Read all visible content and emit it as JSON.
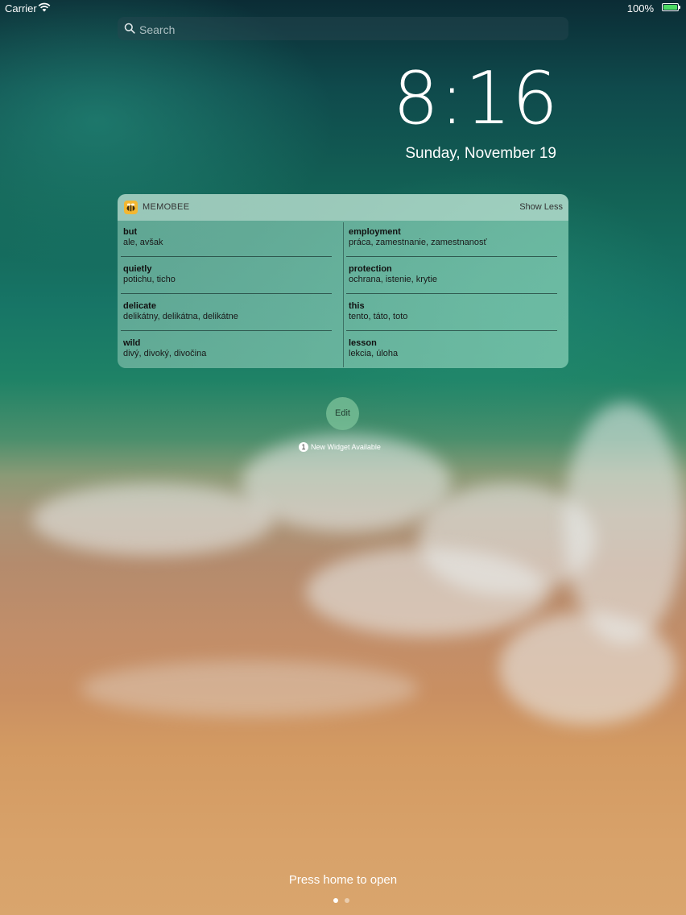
{
  "status_bar": {
    "carrier": "Carrier",
    "battery_percent": "100%"
  },
  "search": {
    "placeholder": "Search"
  },
  "lock_screen": {
    "time": "8:16",
    "date": "Sunday, November 19"
  },
  "widget": {
    "app_name": "MEMOBEE",
    "show_less_label": "Show Less",
    "entries": [
      {
        "word": "but",
        "translation": "ale, avšak"
      },
      {
        "word": "employment",
        "translation": "práca, zamestnanie, zamestnanosť"
      },
      {
        "word": "quietly",
        "translation": "potichu, ticho"
      },
      {
        "word": "protection",
        "translation": "ochrana, istenie, krytie"
      },
      {
        "word": "delicate",
        "translation": "delikátny, delikátna, delikátne"
      },
      {
        "word": "this",
        "translation": "tento, táto, toto"
      },
      {
        "word": "wild",
        "translation": "divý, divoký, divočina"
      },
      {
        "word": "lesson",
        "translation": "lekcia, úloha"
      }
    ]
  },
  "edit_button": {
    "label": "Edit"
  },
  "new_widget": {
    "count": "1",
    "text": "New Widget Available"
  },
  "footer": {
    "press_home": "Press home to open"
  },
  "page_indicator": {
    "pages": 2,
    "current": 1
  },
  "colors": {
    "battery": "#4cd964",
    "app_icon": "#f3b731",
    "edit_button": "#78be96"
  },
  "icons": {
    "search": "search-icon",
    "wifi": "wifi-icon",
    "battery": "battery-icon",
    "app": "memobee-app-icon"
  }
}
